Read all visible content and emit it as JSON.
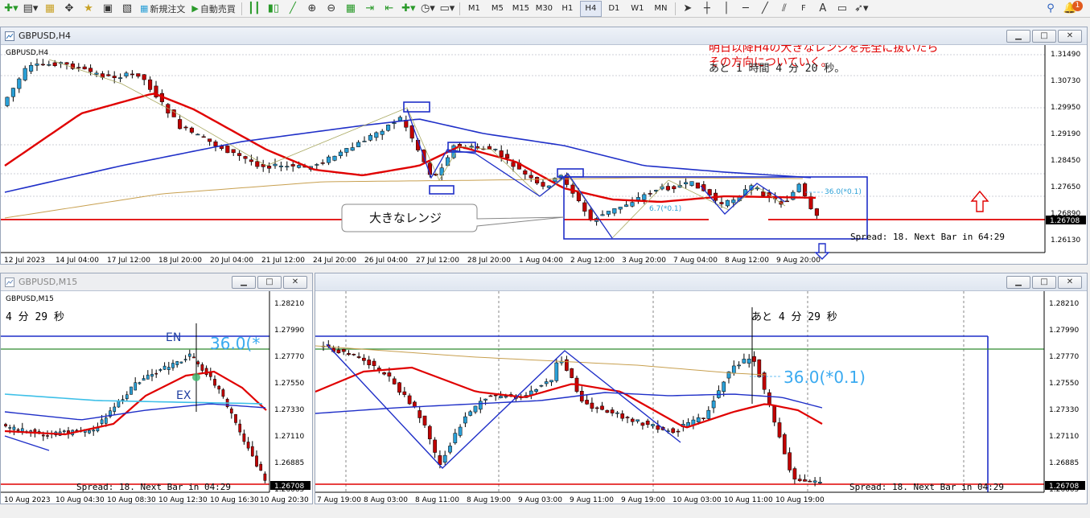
{
  "toolbar": {
    "new_order_label": "新規注文",
    "auto_trade_label": "自動売買",
    "timeframes": [
      "M1",
      "M5",
      "M15",
      "M30",
      "H1",
      "H4",
      "D1",
      "W1",
      "MN"
    ],
    "active_timeframe": "H4",
    "notification_count": "1"
  },
  "window_h4": {
    "title": "GBPUSD,H4",
    "symbol_label": "GBPUSD,H4",
    "annotation_red_line1": "明日以降H4の大きなレンジを完全に抜いたら",
    "annotation_red_line2": "その方向についていく。",
    "countdown": "あと 1 時間 4 分 20 秒。",
    "range_callout": "大きなレンジ",
    "fib_label_right": "36.0(*0.1)",
    "fib_label_left": "6.7(*0.1)",
    "spread_text": "Spread: 18. Next Bar in 64:29",
    "current_price": "1.26708",
    "price_ticks": [
      "1.31490",
      "1.30730",
      "1.29950",
      "1.29190",
      "1.28450",
      "1.27650",
      "1.26890",
      "1.26130"
    ],
    "time_ticks": [
      "12 Jul 2023",
      "14 Jul 04:00",
      "17 Jul 12:00",
      "18 Jul 20:00",
      "20 Jul 04:00",
      "21 Jul 12:00",
      "24 Jul 20:00",
      "26 Jul 04:00",
      "27 Jul 12:00",
      "28 Jul 20:00",
      "1 Aug 04:00",
      "2 Aug 12:00",
      "3 Aug 20:00",
      "7 Aug 04:00",
      "8 Aug 12:00",
      "9 Aug 20:00"
    ]
  },
  "window_m15_small": {
    "title": "GBPUSD,M15",
    "symbol_label": "GBPUSD,M15",
    "countdown": "4 分 29 秒",
    "en_label": "EN",
    "ex_label": "EX",
    "fib_label": "36.0(*",
    "spread_text": "Spread: 18. Next Bar in 04:29",
    "current_price": "1.26708",
    "price_ticks": [
      "1.28210",
      "1.27990",
      "1.27770",
      "1.27550",
      "1.27330",
      "1.27110",
      "1.26885",
      "1.26665"
    ],
    "time_ticks": [
      "10 Aug 2023",
      "10 Aug 04:30",
      "10 Aug 08:30",
      "10 Aug 12:30",
      "10 Aug 16:30",
      "10 Aug 20:30"
    ]
  },
  "window_m15_large": {
    "countdown": "あと 4 分 29 秒",
    "fib_label": "36.0(*0.1)",
    "spread_text": "Spread: 18. Next Bar in 04:29",
    "current_price": "1.26708",
    "price_ticks": [
      "1.28210",
      "1.27990",
      "1.27770",
      "1.27550",
      "1.27330",
      "1.27110",
      "1.26885",
      "1.26665"
    ],
    "time_ticks": [
      "7 Aug 19:00",
      "8 Aug 03:00",
      "8 Aug 11:00",
      "8 Aug 19:00",
      "9 Aug 03:00",
      "9 Aug 11:00",
      "9 Aug 19:00",
      "10 Aug 03:00",
      "10 Aug 11:00",
      "10 Aug 19:00"
    ]
  },
  "colors": {
    "bull": "#2a9fd6",
    "bear": "#c00000",
    "ma_fast": "#e00000",
    "ma_slow": "#1f2fc8",
    "ma_long": "#c8a050",
    "annotation_blue": "#1f2fc8",
    "support_red": "#e00000",
    "green_line": "#2e8b2e"
  }
}
